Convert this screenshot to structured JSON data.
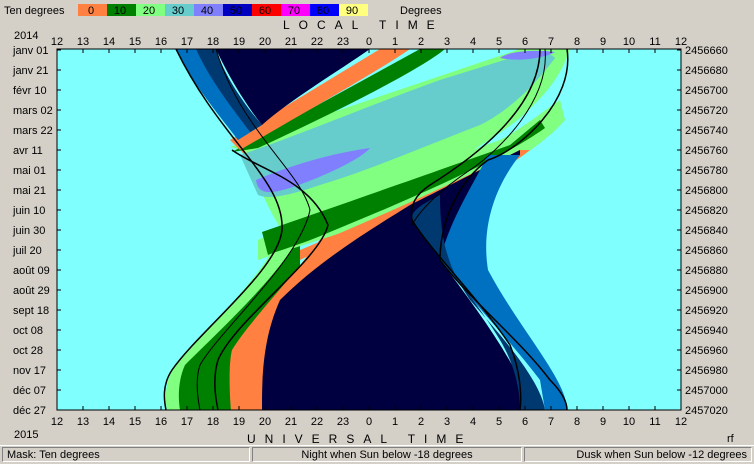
{
  "legend": {
    "title": "Ten degrees",
    "unit": "Degrees",
    "ticks": [
      "0",
      "10",
      "20",
      "30",
      "40",
      "50",
      "60",
      "70",
      "80",
      "90"
    ],
    "colors": [
      "#ff8040",
      "#008000",
      "#80ff80",
      "#66cccc",
      "#8080ff",
      "#0000c0",
      "#ff0000",
      "#ff00ff",
      "#0000ff",
      "#ffff80"
    ]
  },
  "header": {
    "local_time": "LOCAL TIME",
    "universal_time": "UNIVERSAL TIME"
  },
  "corners": {
    "year_start": "2014",
    "year_end": "2015",
    "flag": "rf"
  },
  "status": {
    "mask": "Mask:  Ten degrees",
    "night": "Night when Sun below -18 degrees",
    "dusk": "Dusk when Sun below -12 degrees"
  },
  "chart_data": {
    "type": "heatmap",
    "x_ticks": [
      "12",
      "13",
      "14",
      "15",
      "16",
      "17",
      "18",
      "19",
      "20",
      "21",
      "22",
      "23",
      "0",
      "1",
      "2",
      "3",
      "4",
      "5",
      "6",
      "7",
      "8",
      "9",
      "10",
      "11",
      "12"
    ],
    "y_left_labels": [
      "janv 01",
      "janv 21",
      "févr 10",
      "mars 02",
      "mars 22",
      "avr 11",
      "mai 01",
      "mai 21",
      "juin 10",
      "juin 30",
      "juil 20",
      "août 09",
      "août 29",
      "sept 18",
      "oct 08",
      "oct 28",
      "nov 17",
      "déc 07",
      "déc 27"
    ],
    "y_right_labels": [
      "2456660",
      "2456680",
      "2456700",
      "2456720",
      "2456740",
      "2456760",
      "2456780",
      "2456800",
      "2456820",
      "2456840",
      "2456860",
      "2456880",
      "2456900",
      "2456920",
      "2456940",
      "2456960",
      "2456980",
      "2457000",
      "2457020"
    ],
    "colors": {
      "background": "#80ffff",
      "night": "#000040",
      "dusk": "#003870",
      "twilight": "#0070c0"
    }
  }
}
